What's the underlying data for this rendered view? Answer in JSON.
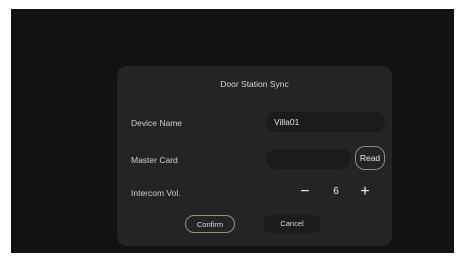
{
  "dialog": {
    "title": "Door Station Sync",
    "device_name": {
      "label": "Device Name",
      "value": "Villa01"
    },
    "master_card": {
      "label": "Master Card",
      "value": "",
      "read_label": "Read"
    },
    "intercom_vol": {
      "label": "Intercom Vol.",
      "value": "6",
      "minus": "−",
      "plus": "+"
    },
    "confirm_label": "Confirm",
    "cancel_label": "Cancel"
  },
  "colors": {
    "screen_bg": "#121212",
    "dialog_bg": "#242424",
    "field_bg": "#1b1b1b",
    "confirm_border": "#9a8f7c"
  },
  "icons": [
    "minus-icon",
    "plus-icon"
  ]
}
